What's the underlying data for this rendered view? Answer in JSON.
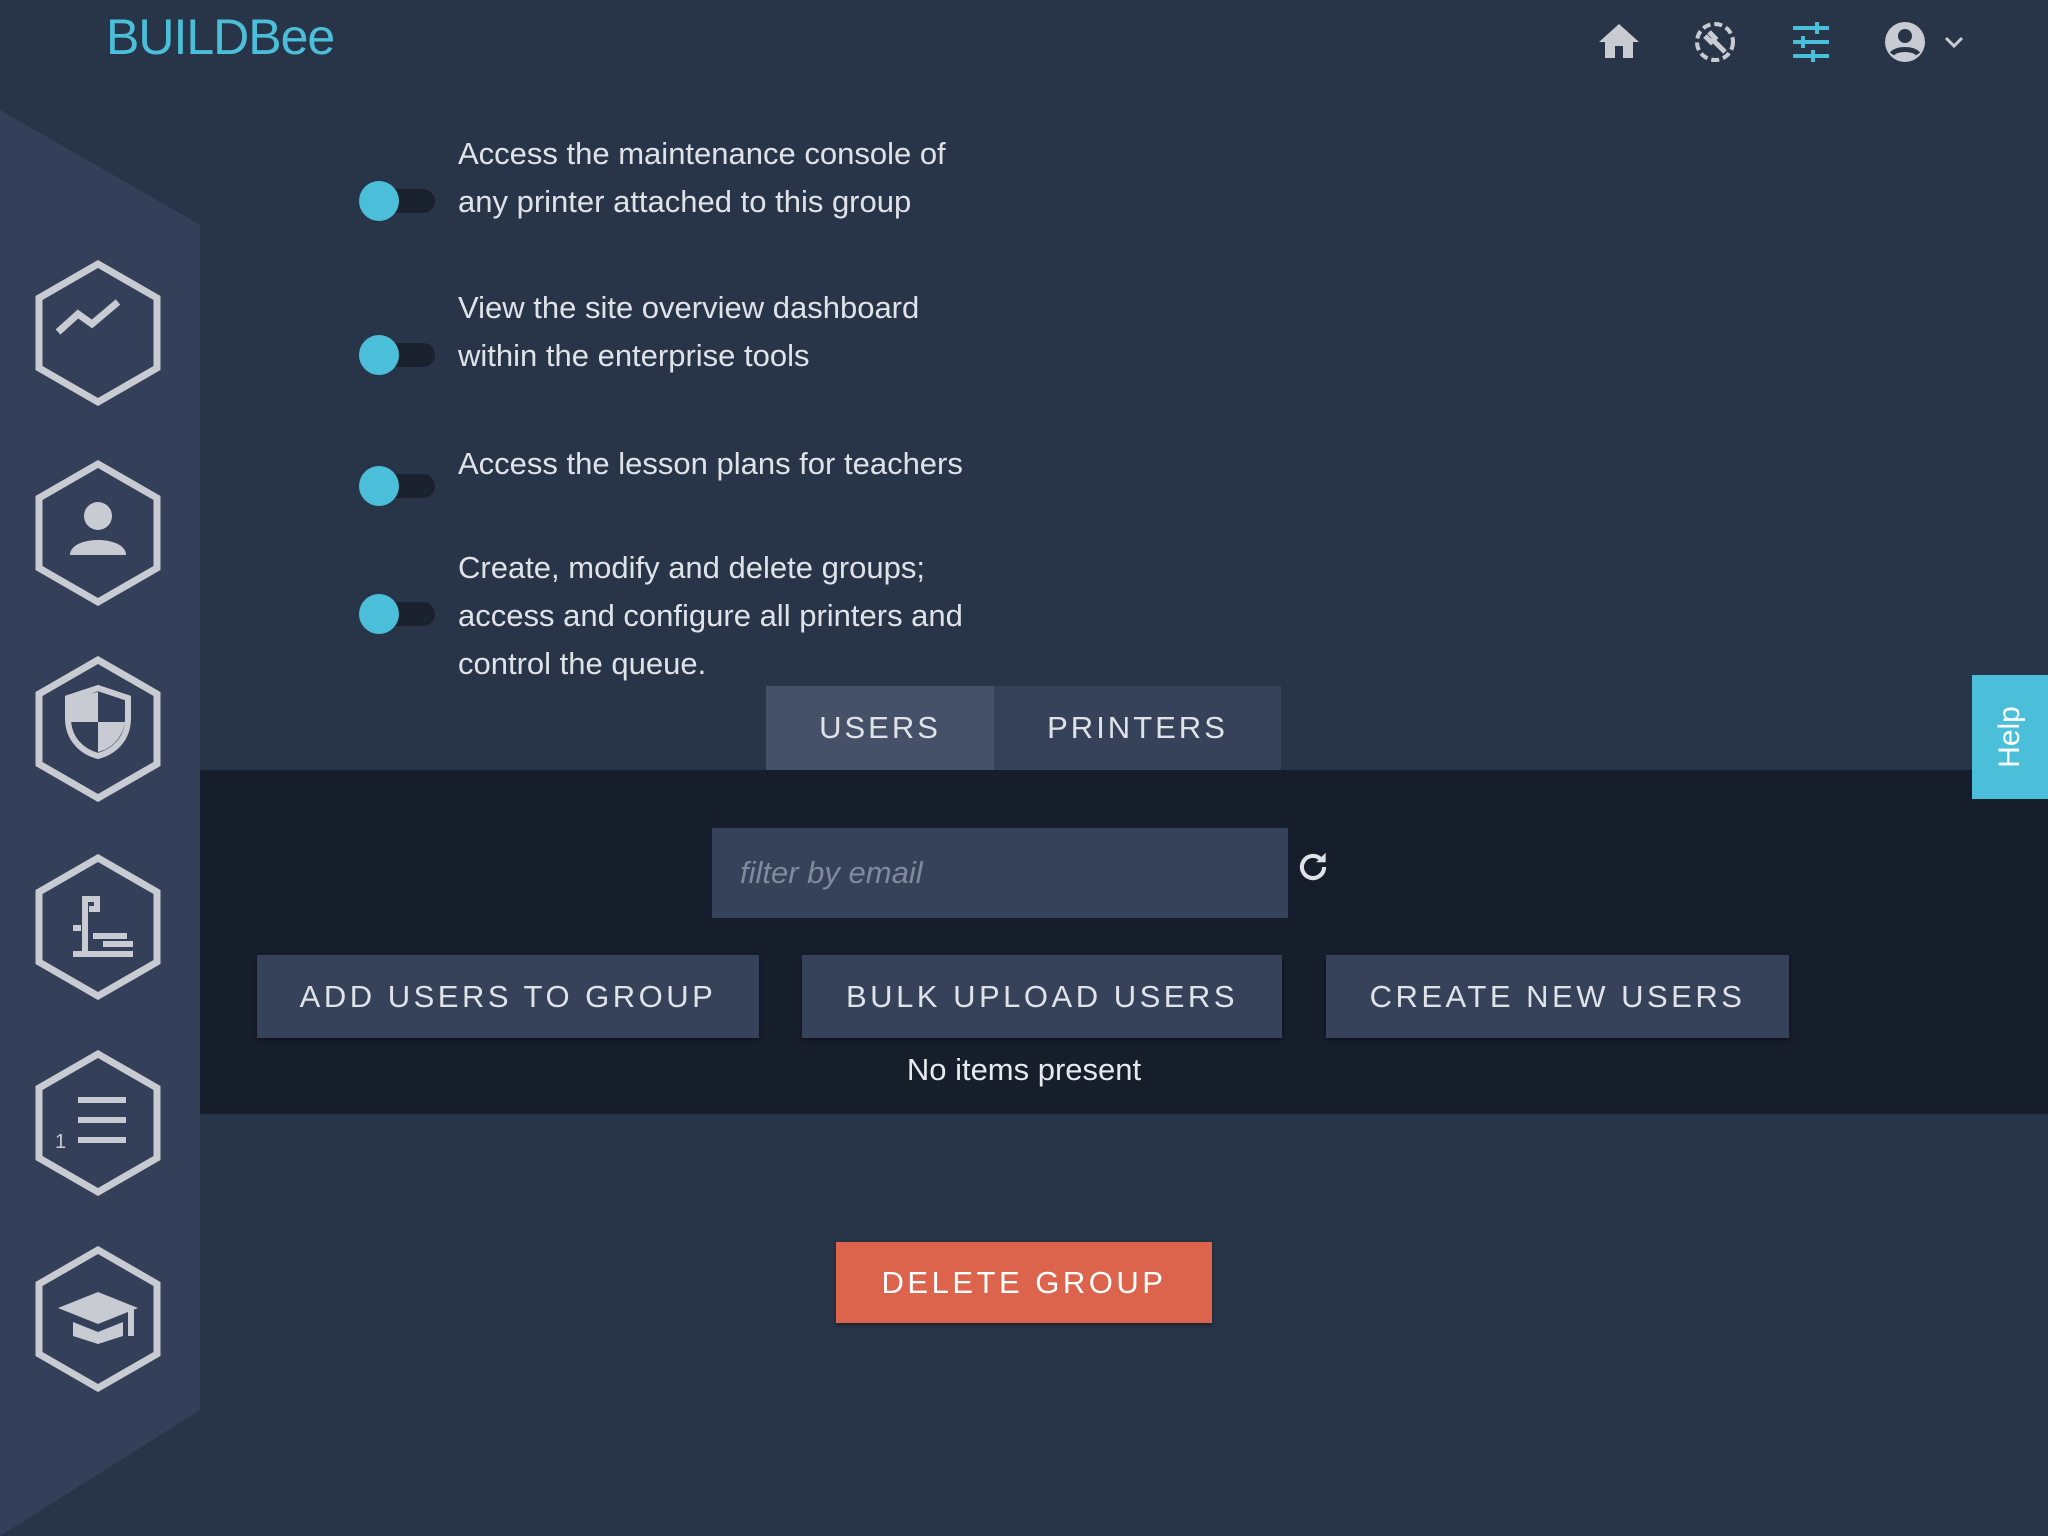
{
  "brand": {
    "logo_text": "BUILDBee",
    "accent": "#4bbfd9"
  },
  "header": {
    "icons": [
      "home-icon",
      "maintenance-icon",
      "settings-sliders-icon",
      "account-icon",
      "chevron-down-icon"
    ]
  },
  "sidebar": {
    "items": [
      "analytics",
      "users",
      "security",
      "printers",
      "queue",
      "education"
    ]
  },
  "permissions": [
    {
      "text": "Access the maintenance console of any printer attached to this group",
      "enabled": true
    },
    {
      "text": "View the site overview dashboard within the enterprise tools",
      "enabled": true
    },
    {
      "text": "Access the lesson plans for teachers",
      "enabled": true
    },
    {
      "text": "Create, modify and delete groups; access and configure all printers and control the queue.",
      "enabled": true
    }
  ],
  "tabs": {
    "users": "USERS",
    "printers": "PRINTERS",
    "active": "USERS"
  },
  "filter": {
    "placeholder": "filter by email",
    "value": ""
  },
  "actions": {
    "add": "ADD USERS TO GROUP",
    "bulk": "BULK UPLOAD USERS",
    "create": "CREATE NEW USERS"
  },
  "empty_text": "No items present",
  "delete_label": "DELETE GROUP",
  "help_label": "Help",
  "colors": {
    "background": "#283548",
    "sidebar": "#34405a",
    "danger": "#dc644c",
    "band": "#161e2c"
  }
}
